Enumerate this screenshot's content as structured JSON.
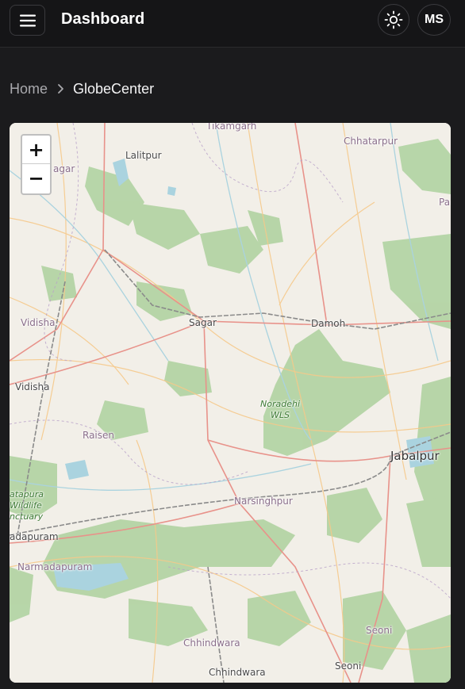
{
  "header": {
    "title": "Dashboard",
    "avatar_initials": "MS",
    "icons": {
      "menu": "menu-icon",
      "theme": "sun-icon"
    }
  },
  "breadcrumb": {
    "home": "Home",
    "current": "GlobeCenter",
    "separator_icon": "chevron-right-icon"
  },
  "map": {
    "zoom_in": "+",
    "zoom_out": "−",
    "colors": {
      "land": "#f2efe8",
      "forest": "#add19e",
      "water": "#aad3df",
      "major_road": "#e8928a",
      "minor_road": "#f6c98a",
      "rail": "#8a8a8a"
    },
    "labels": {
      "tikamgarh": "Tikamgarh",
      "chhatarpur": "Chhatarpur",
      "lalitpur": "Lalitpur",
      "sagar_w": "agar",
      "pa": "Pa",
      "vidisha_faded": "Vidisha",
      "sagar": "Sagar",
      "damoh": "Damoh",
      "vidisha": "Vidisha",
      "noradehi_1": "Noradehi",
      "noradehi_2": "WLS",
      "raisen": "Raisen",
      "jabalpur": "Jabalpur",
      "satpura_1": "atapura",
      "satpura_2": "Wildlife",
      "satpura_3": "nctuary",
      "narsinghpur": "Narsinghpur",
      "narmadapuram_1": "adapuram",
      "narmadapuram_2": "Narmadapuram",
      "seoni_faded": "Seoni",
      "chhindwara_faded": "Chhindwara",
      "seoni": "Seoni",
      "chhindwara": "Chhindwara"
    }
  }
}
